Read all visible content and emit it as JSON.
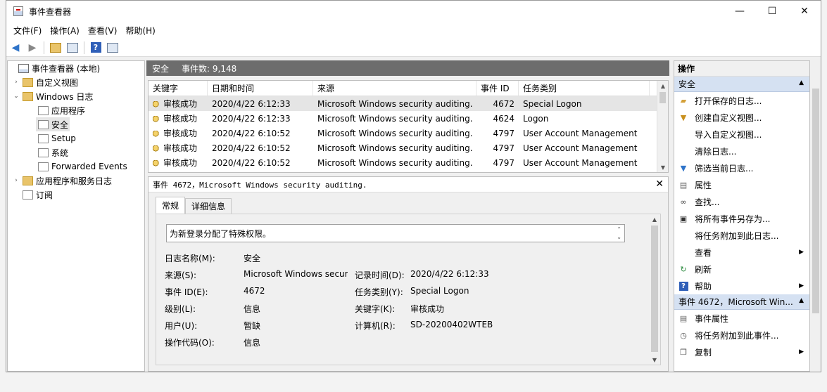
{
  "window": {
    "title": "事件查看器",
    "minimize": "—",
    "maximize": "☐",
    "close": "✕"
  },
  "menu": [
    "文件(F)",
    "操作(A)",
    "查看(V)",
    "帮助(H)"
  ],
  "tree": {
    "root": "事件查看器 (本地)",
    "custom_views": "自定义视图",
    "windows_logs": "Windows 日志",
    "application": "应用程序",
    "security": "安全",
    "setup": "Setup",
    "system": "系统",
    "forwarded": "Forwarded Events",
    "app_services": "应用程序和服务日志",
    "subscriptions": "订阅"
  },
  "center": {
    "log_name": "安全",
    "event_count": "事件数: 9,148",
    "columns": [
      "关键字",
      "日期和时间",
      "来源",
      "事件 ID",
      "任务类别"
    ],
    "rows": [
      {
        "keyword": "审核成功",
        "datetime": "2020/4/22 6:12:33",
        "source": "Microsoft Windows security auditing.",
        "id": "4672",
        "category": "Special Logon"
      },
      {
        "keyword": "审核成功",
        "datetime": "2020/4/22 6:12:33",
        "source": "Microsoft Windows security auditing.",
        "id": "4624",
        "category": "Logon"
      },
      {
        "keyword": "审核成功",
        "datetime": "2020/4/22 6:10:52",
        "source": "Microsoft Windows security auditing.",
        "id": "4797",
        "category": "User Account Management"
      },
      {
        "keyword": "审核成功",
        "datetime": "2020/4/22 6:10:52",
        "source": "Microsoft Windows security auditing.",
        "id": "4797",
        "category": "User Account Management"
      },
      {
        "keyword": "审核成功",
        "datetime": "2020/4/22 6:10:52",
        "source": "Microsoft Windows security auditing.",
        "id": "4797",
        "category": "User Account Management"
      }
    ]
  },
  "detail": {
    "header": "事件 4672，Microsoft Windows security auditing.",
    "close": "✕",
    "tab_general": "常规",
    "tab_details": "详细信息",
    "message": "为新登录分配了特殊权限。",
    "labels": {
      "log_name": "日志名称(M):",
      "source": "来源(S):",
      "event_id": "事件 ID(E):",
      "level": "级别(L):",
      "user": "用户(U):",
      "opcode": "操作代码(O):",
      "logged": "记录时间(D):",
      "task_category": "任务类别(Y):",
      "keywords": "关键字(K):",
      "computer": "计算机(R):"
    },
    "values": {
      "log_name": "安全",
      "source": "Microsoft Windows securi",
      "event_id": "4672",
      "level": "信息",
      "user": "暂缺",
      "opcode": "信息",
      "logged": "2020/4/22 6:12:33",
      "task_category": "Special Logon",
      "keywords": "审核成功",
      "computer": "SD-20200402WTEB"
    }
  },
  "actions": {
    "title": "操作",
    "section1": "安全",
    "items1": [
      "打开保存的日志...",
      "创建自定义视图...",
      "导入自定义视图...",
      "清除日志...",
      "筛选当前日志...",
      "属性",
      "查找...",
      "将所有事件另存为...",
      "将任务附加到此日志...",
      "查看",
      "刷新",
      "帮助"
    ],
    "section2": "事件 4672，Microsoft Win...",
    "items2": [
      "事件属性",
      "将任务附加到此事件...",
      "复制"
    ]
  }
}
